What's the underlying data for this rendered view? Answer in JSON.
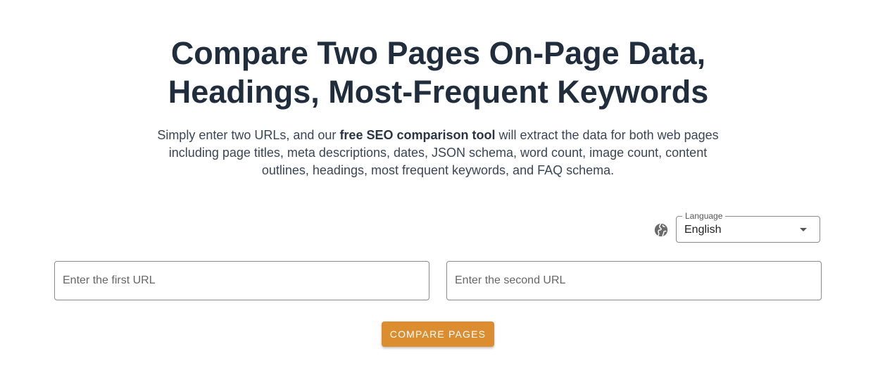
{
  "header": {
    "title_line1": "Compare Two Pages On-Page Data,",
    "title_line2": "Headings, Most-Frequent Keywords"
  },
  "description": {
    "part1": "Simply enter two URLs, and our ",
    "bold": "free SEO comparison tool",
    "part2": " will extract the data for both web pages including page titles, meta descriptions, dates, JSON schema, word count, image count, content outlines, headings, most frequent keywords, and FAQ schema."
  },
  "language": {
    "icon": "globe-icon",
    "label": "Language",
    "selected": "English"
  },
  "inputs": {
    "first_placeholder": "Enter the first URL",
    "second_placeholder": "Enter the second URL"
  },
  "compare_button": {
    "label": "COMPARE PAGES",
    "color": "#dc8d2f"
  },
  "colors": {
    "heading": "#1f2d3d",
    "text": "#3a4656"
  }
}
